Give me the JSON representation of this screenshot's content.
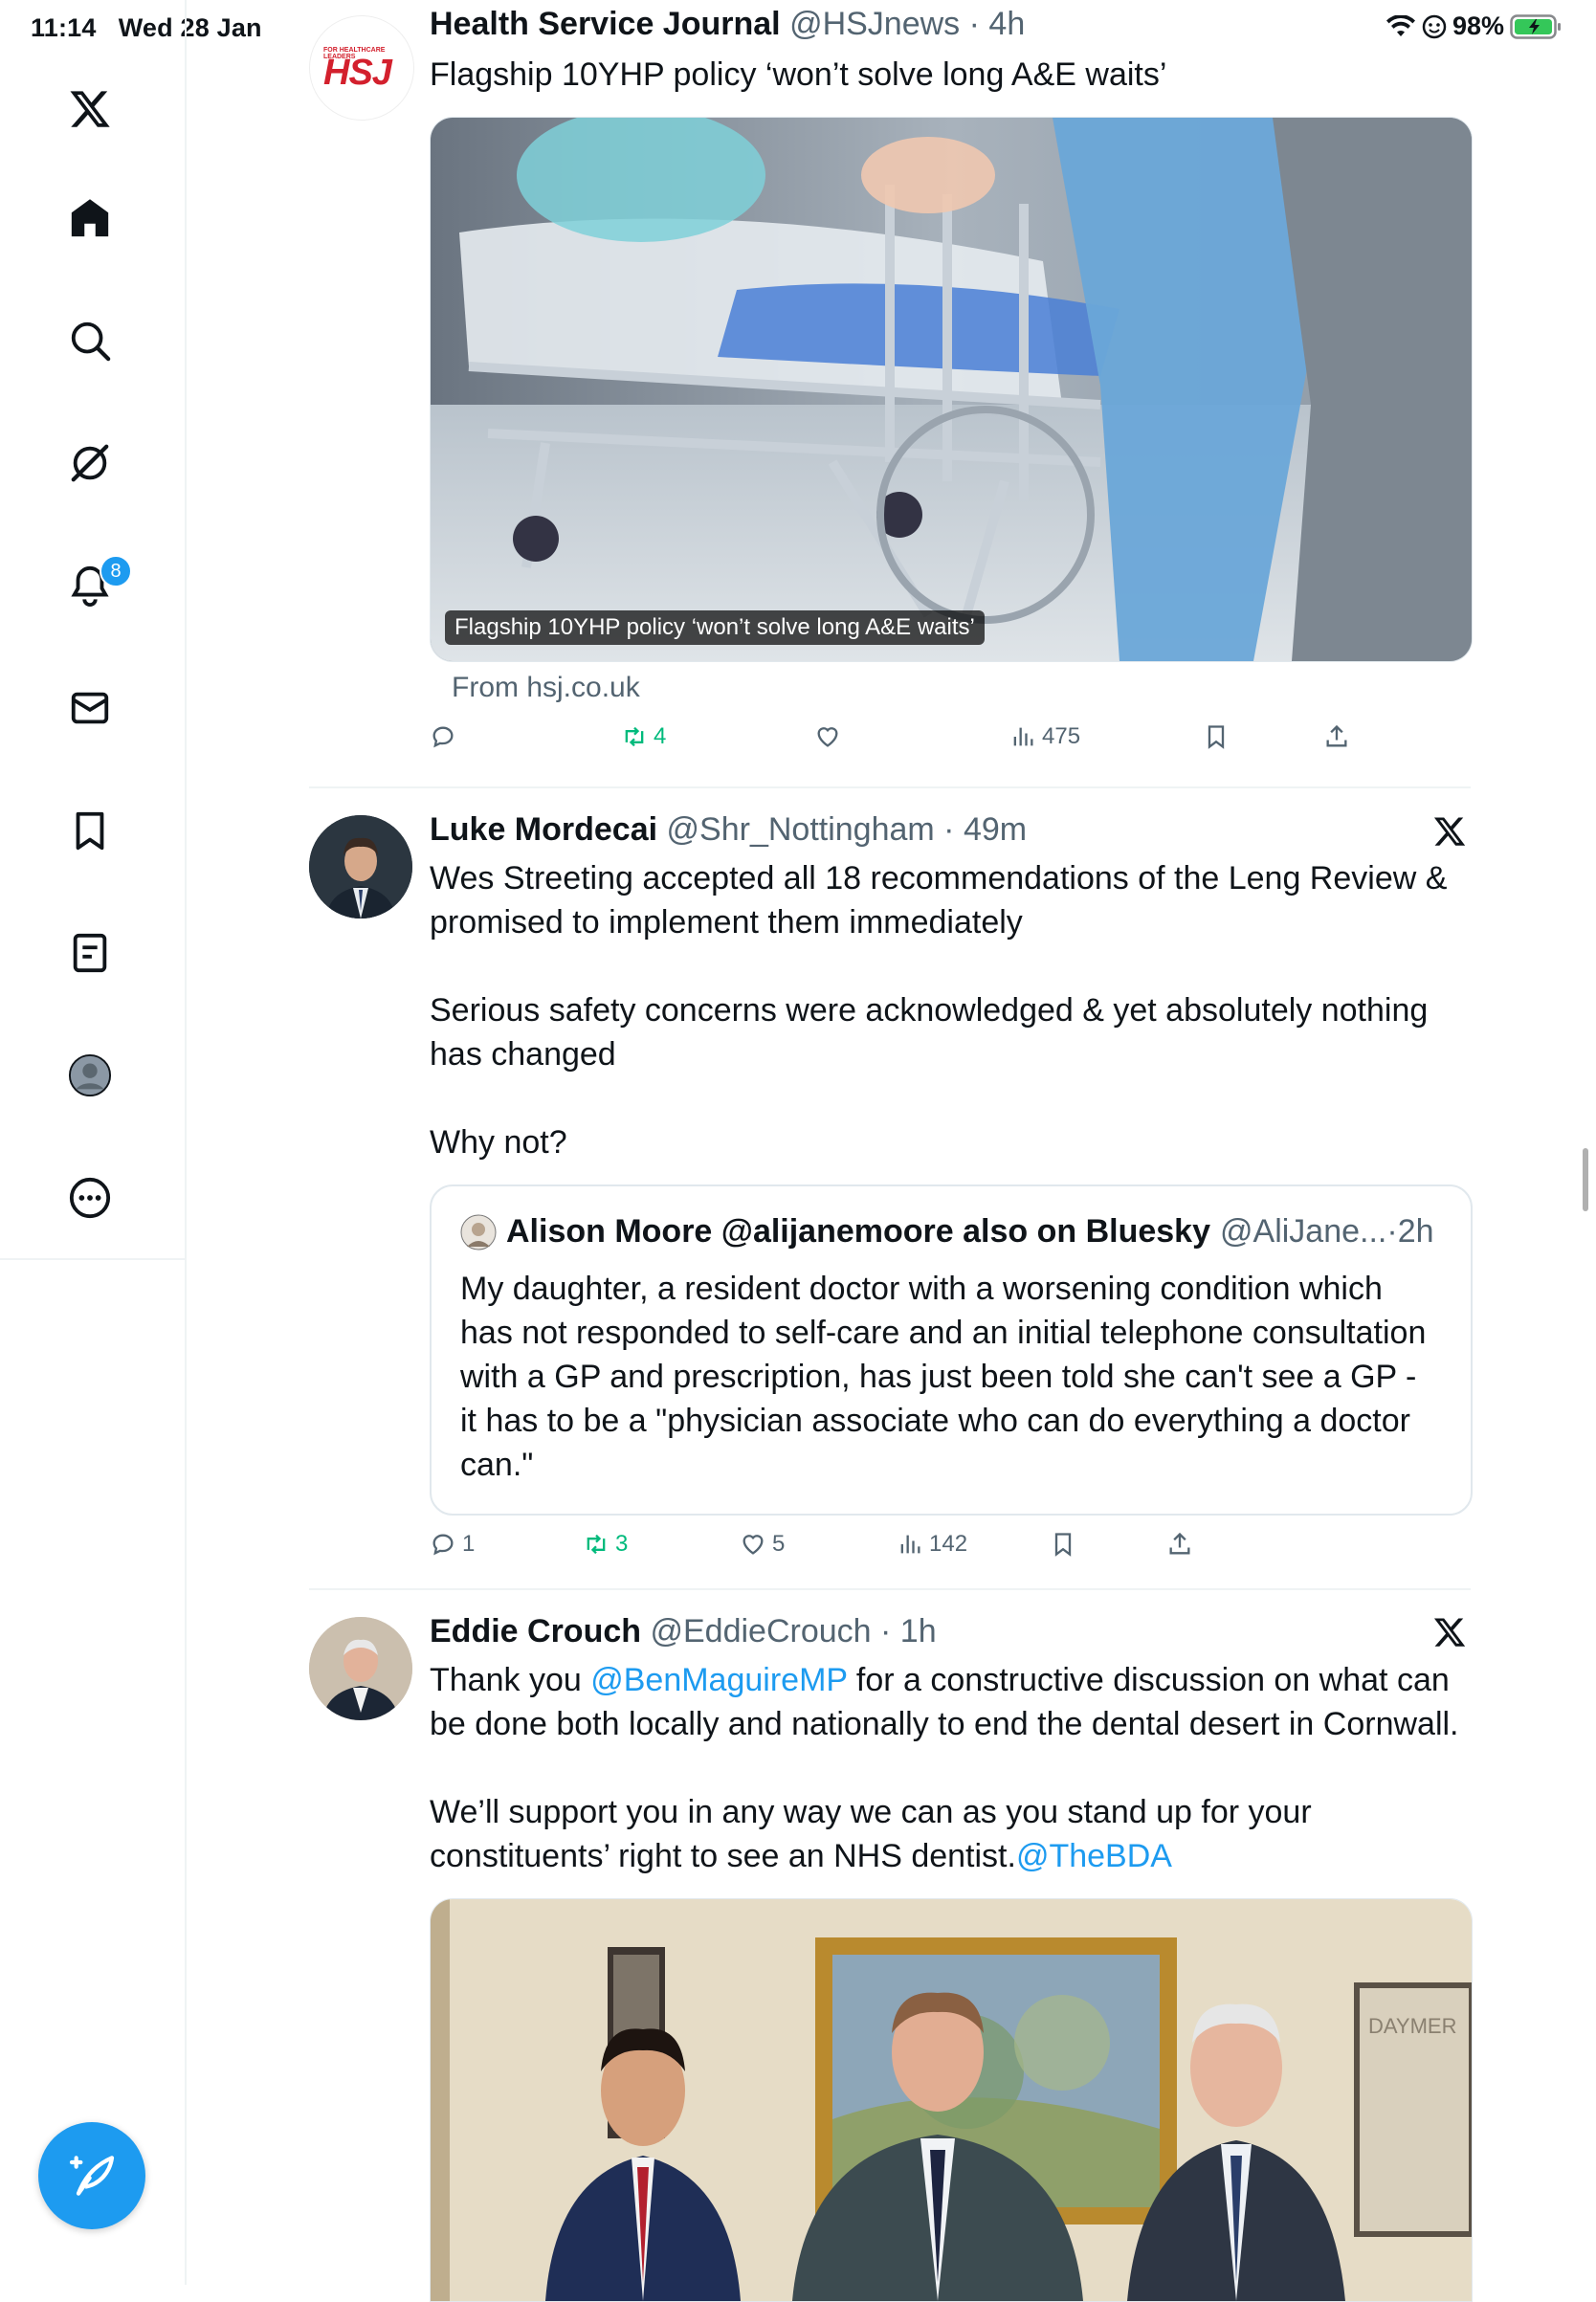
{
  "status_bar": {
    "time": "11:14",
    "date": "Wed 28 Jan",
    "battery": "98%"
  },
  "sidebar": {
    "items": [
      {
        "name": "x-logo"
      },
      {
        "name": "home"
      },
      {
        "name": "search"
      },
      {
        "name": "grok"
      },
      {
        "name": "notifications"
      },
      {
        "name": "messages"
      },
      {
        "name": "bookmarks"
      },
      {
        "name": "lists"
      },
      {
        "name": "profile"
      },
      {
        "name": "more"
      }
    ],
    "notifications_badge": "8"
  },
  "tweets": [
    {
      "author": "Health Service Journal",
      "handle": "@HSJnews",
      "time": "4h",
      "avatar_text": "HSJ",
      "avatar_subtext": "FOR HEALTHCARE LEADERS",
      "text": "Flagship 10YHP policy ‘won’t solve long A&E waits’",
      "card_caption": "Flagship 10YHP policy ‘won’t solve long A&E waits’",
      "card_source": "From hsj.co.uk",
      "replies": "",
      "retweets": "4",
      "likes": "",
      "views": "475"
    },
    {
      "author": "Luke Mordecai",
      "handle": "@Shr_Nottingham",
      "time": "49m",
      "paragraphs": [
        "Wes Streeting accepted all 18 recommendations of the Leng Review & promised to implement them immediately",
        "Serious safety concerns were acknowledged & yet absolutely nothing has changed",
        "Why not?"
      ],
      "quote": {
        "author": "Alison Moore @alijanemoore also on Bluesky",
        "handle": "@AliJane...",
        "time": "2h",
        "text": "My daughter, a resident doctor with a worsening condition which has not responded to self-care and an initial telephone consultation with a GP and prescription, has just been told she can't see a GP - it has to be a \"physician associate who can do everything a doctor can.\""
      },
      "replies": "1",
      "retweets": "3",
      "likes": "5",
      "views": "142"
    },
    {
      "author": "Eddie Crouch",
      "handle": "@EddieCrouch",
      "time": "1h",
      "text_1a": "Thank you ",
      "mention_1": "@BenMaguireMP",
      "text_1b": " for a constructive discussion on what can be done both locally and nationally to end the dental desert in Cornwall.",
      "text_2a": "We’ll support you in any way we can as you stand up for your constituents’ right to see an NHS dentist.",
      "mention_2": "@TheBDA",
      "photo_sign_text": "DAYMER"
    }
  ]
}
